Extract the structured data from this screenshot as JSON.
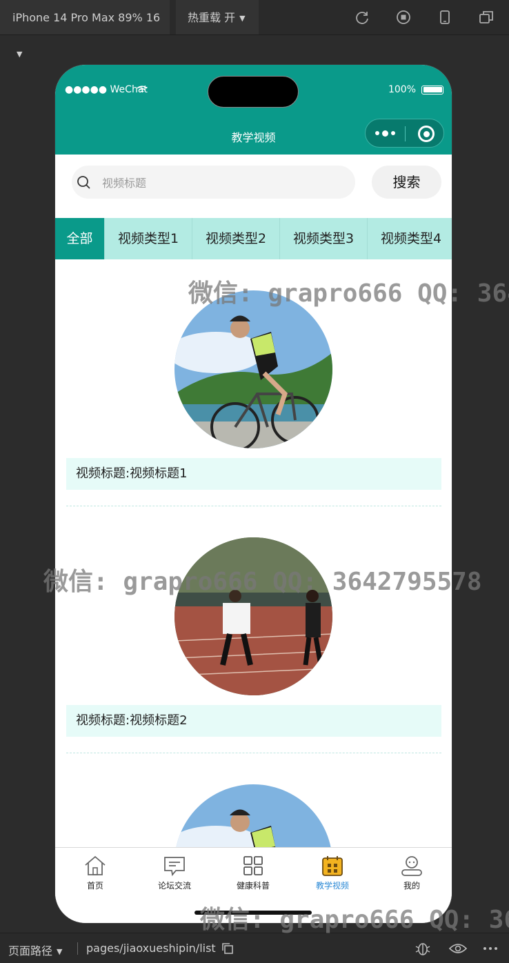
{
  "toolbar": {
    "device": "iPhone 14 Pro Max 89% 16",
    "hot_reload": "热重载 开"
  },
  "status": {
    "carrier": "●●●●● WeChat",
    "battery": "100%"
  },
  "navbar": {
    "title": "教学视频"
  },
  "search": {
    "placeholder": "视频标题",
    "value": "",
    "button": "搜索"
  },
  "tabs": [
    {
      "label": "全部",
      "active": true
    },
    {
      "label": "视频类型1",
      "active": false
    },
    {
      "label": "视频类型2",
      "active": false
    },
    {
      "label": "视频类型3",
      "active": false
    },
    {
      "label": "视频类型4",
      "active": false
    }
  ],
  "videos": [
    {
      "caption": "视频标题:视频标题1",
      "image": "cyclist"
    },
    {
      "caption": "视频标题:视频标题2",
      "image": "relay-track"
    },
    {
      "caption": "",
      "image": "cyclist"
    }
  ],
  "tabbar": [
    {
      "label": "首页",
      "icon": "home-icon",
      "active": false
    },
    {
      "label": "论坛交流",
      "icon": "message-icon",
      "active": false
    },
    {
      "label": "健康科普",
      "icon": "grid-icon",
      "active": false
    },
    {
      "label": "教学视频",
      "icon": "calendar-icon",
      "active": true
    },
    {
      "label": "我的",
      "icon": "user-icon",
      "active": false
    }
  ],
  "bottombar": {
    "page_path_label": "页面路径",
    "path": "pages/jiaoxueshipin/list"
  },
  "watermark": {
    "line1": "微信: grapro666 QQ: 364",
    "line2": "微信: grapro666 QQ: 3642795578",
    "line3": "微信: grapro666 QQ: 36"
  },
  "colors": {
    "primary": "#0a9a8a",
    "tab_bg": "#b3ebe3",
    "caption_bg": "#e6fbf8",
    "active_tab_text": "#2c8ad6"
  }
}
